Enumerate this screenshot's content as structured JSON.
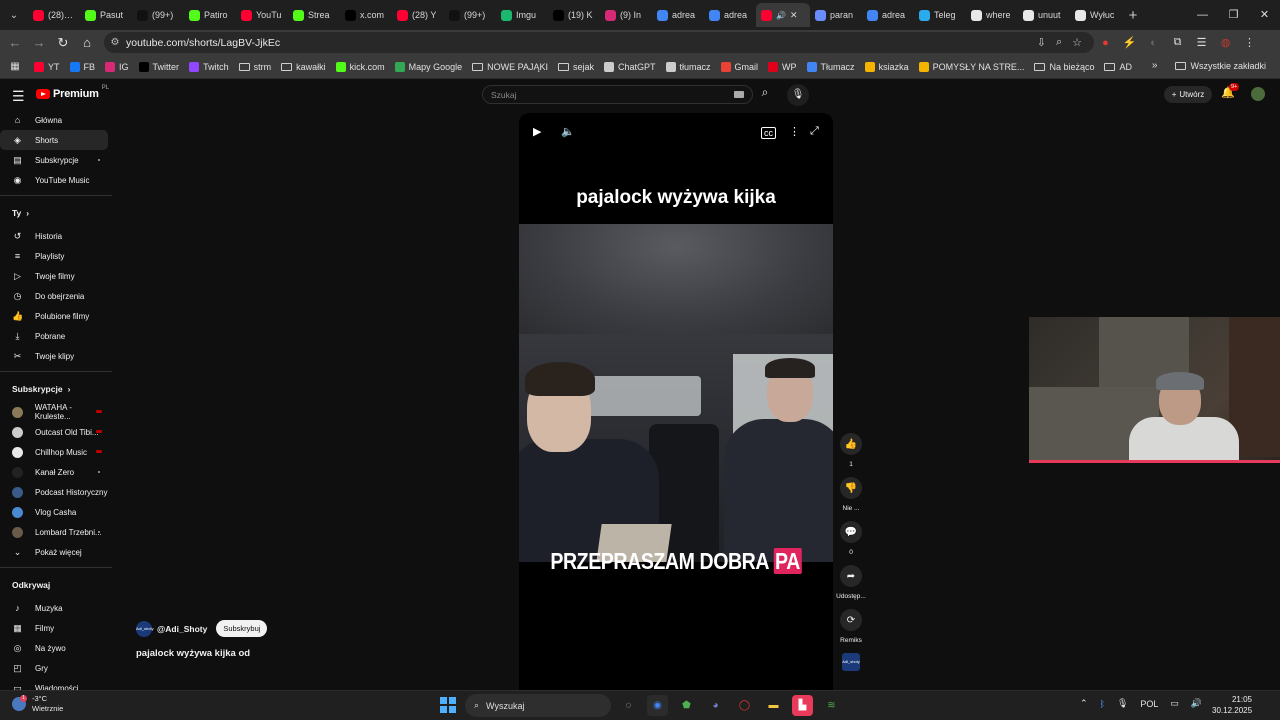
{
  "browser": {
    "tabs": [
      {
        "title": "(28) Ju",
        "color": "#ff0033"
      },
      {
        "title": "Pasut",
        "color": "#53fc18"
      },
      {
        "title": "(99+)",
        "color": "#111111"
      },
      {
        "title": "Patiro",
        "color": "#53fc18"
      },
      {
        "title": "YouTu",
        "color": "#ff0033"
      },
      {
        "title": "Strea",
        "color": "#53fc18"
      },
      {
        "title": "x.com",
        "color": "#000000"
      },
      {
        "title": "(28) Y",
        "color": "#ff0033"
      },
      {
        "title": "(99+)",
        "color": "#111111"
      },
      {
        "title": "Imgu",
        "color": "#1bb76e"
      },
      {
        "title": "(19) K",
        "color": "#000000"
      },
      {
        "title": "(9) In",
        "color": "#d62976"
      },
      {
        "title": "adrea",
        "color": "#4285f4"
      },
      {
        "title": "adrea",
        "color": "#4285f4"
      },
      {
        "title": "",
        "color": "#ff0033",
        "active": true
      },
      {
        "title": "paran",
        "color": "#6b8cff"
      },
      {
        "title": "adrea",
        "color": "#4285f4"
      },
      {
        "title": "Teleg",
        "color": "#2aabee"
      },
      {
        "title": "where",
        "color": "#e8e8e8"
      },
      {
        "title": "unuut",
        "color": "#e8e8e8"
      },
      {
        "title": "Wyłuc",
        "color": "#e8e8e8"
      }
    ],
    "url": "youtube.com/shorts/LagBV-JjkEc"
  },
  "bookmarks": {
    "items": [
      {
        "label": "YT",
        "type": "site",
        "color": "#ff0033"
      },
      {
        "label": "FB",
        "type": "site",
        "color": "#1877f2"
      },
      {
        "label": "IG",
        "type": "site",
        "color": "#d62976"
      },
      {
        "label": "Twitter",
        "type": "site",
        "color": "#000000"
      },
      {
        "label": "Twitch",
        "type": "site",
        "color": "#9146ff"
      },
      {
        "label": "strm",
        "type": "folder"
      },
      {
        "label": "kawałki",
        "type": "folder"
      },
      {
        "label": "kick.com",
        "type": "site",
        "color": "#53fc18"
      },
      {
        "label": "Mapy Google",
        "type": "site",
        "color": "#34a853"
      },
      {
        "label": "NOWE PAJĄKI",
        "type": "folder"
      },
      {
        "label": "sejak",
        "type": "folder"
      },
      {
        "label": "ChatGPT",
        "type": "site",
        "color": "#cccccc"
      },
      {
        "label": "tłumacz",
        "type": "site",
        "color": "#cccccc"
      },
      {
        "label": "Gmail",
        "type": "site",
        "color": "#ea4335"
      },
      {
        "label": "WP",
        "type": "site",
        "color": "#e0001b"
      },
      {
        "label": "Tłumacz",
        "type": "site",
        "color": "#4285f4"
      },
      {
        "label": "ksiazka",
        "type": "site",
        "color": "#f4b400"
      },
      {
        "label": "POMYSŁY NA STRE...",
        "type": "site",
        "color": "#f4b400"
      },
      {
        "label": "Na bieżąco",
        "type": "folder"
      },
      {
        "label": "AD",
        "type": "folder"
      }
    ],
    "all_bookmarks": "Wszystkie zakładki"
  },
  "youtube": {
    "logo": "Premium",
    "country": "PL",
    "search_placeholder": "Szukaj",
    "create_label": "Utwórz",
    "notif_count": "9+",
    "sidebar_main": [
      {
        "label": "Główna",
        "icon": "home-icon",
        "glyph": "⌂"
      },
      {
        "label": "Shorts",
        "icon": "shorts-icon",
        "glyph": "◈",
        "selected": true
      },
      {
        "label": "Subskrypcje",
        "icon": "subscriptions-icon",
        "glyph": "▤",
        "dot": true
      },
      {
        "label": "YouTube Music",
        "icon": "music-icon",
        "glyph": "◉"
      }
    ],
    "you_header": "Ty",
    "sidebar_you": [
      {
        "label": "Historia",
        "icon": "history-icon",
        "glyph": "↺"
      },
      {
        "label": "Playlisty",
        "icon": "playlists-icon",
        "glyph": "≡"
      },
      {
        "label": "Twoje filmy",
        "icon": "your-videos-icon",
        "glyph": "▷"
      },
      {
        "label": "Do obejrzenia",
        "icon": "watch-later-icon",
        "glyph": "◷"
      },
      {
        "label": "Polubione filmy",
        "icon": "liked-icon",
        "glyph": "👍"
      },
      {
        "label": "Pobrane",
        "icon": "download-icon",
        "glyph": "⤓"
      },
      {
        "label": "Twoje klipy",
        "icon": "clips-icon",
        "glyph": "✂"
      }
    ],
    "subs_header": "Subskrypcje",
    "subscriptions": [
      {
        "label": "WATAHA - Kruleste...",
        "color": "#8a7a5a",
        "live": true
      },
      {
        "label": "Outcast Old Tibi...",
        "color": "#cccccc",
        "live": true
      },
      {
        "label": "Chillhop Music",
        "color": "#e8e8e8",
        "live": true
      },
      {
        "label": "Kanał Zero",
        "color": "#222222",
        "dot": true
      },
      {
        "label": "Podcast Historyczny",
        "color": "#3a5a8a"
      },
      {
        "label": "Vlog Casha",
        "color": "#4a8ad0"
      },
      {
        "label": "Lombard Trzebni...",
        "color": "#6a5a4a",
        "dot": true
      }
    ],
    "show_more": "Pokaż więcej",
    "explore_header": "Odkrywaj",
    "explore": [
      {
        "label": "Muzyka",
        "icon": "music-note-icon",
        "glyph": "♪"
      },
      {
        "label": "Filmy",
        "icon": "movies-icon",
        "glyph": "▦"
      },
      {
        "label": "Na żywo",
        "icon": "live-icon",
        "glyph": "◎"
      },
      {
        "label": "Gry",
        "icon": "games-icon",
        "glyph": "◰"
      },
      {
        "label": "Wiadomości",
        "icon": "news-icon",
        "glyph": "▭"
      }
    ],
    "short": {
      "overlay_title": "pajalock wyżywa kijka",
      "caption_main": "PRZEPRASZAM DOBRA ",
      "caption_highlight": "PA",
      "channel": "@Adi_Shoty",
      "channel_avatar_text": "Adi_shoty",
      "subscribe": "Subskrybuj",
      "title": "pajalock wyżywa kijka od",
      "progress": 0.9
    },
    "actions": [
      {
        "name": "like-button",
        "icon": "thumbs-up-icon",
        "glyph": "👍",
        "label": "1"
      },
      {
        "name": "dislike-button",
        "icon": "thumbs-down-icon",
        "glyph": "👎",
        "label": "Nie ..."
      },
      {
        "name": "comments-button",
        "icon": "comment-icon",
        "glyph": "💬",
        "label": "0"
      },
      {
        "name": "share-button",
        "icon": "share-icon",
        "glyph": "➦",
        "label": "Udostęp..."
      },
      {
        "name": "remix-button",
        "icon": "remix-icon",
        "glyph": "⟳",
        "label": "Remiks"
      }
    ]
  },
  "taskbar": {
    "temperature": "-3°C",
    "weather": "Wietrznie",
    "weather_badge": "1",
    "search": "Wyszukaj",
    "lang": "POL",
    "time": "21:05",
    "date": "30.12.2025"
  }
}
